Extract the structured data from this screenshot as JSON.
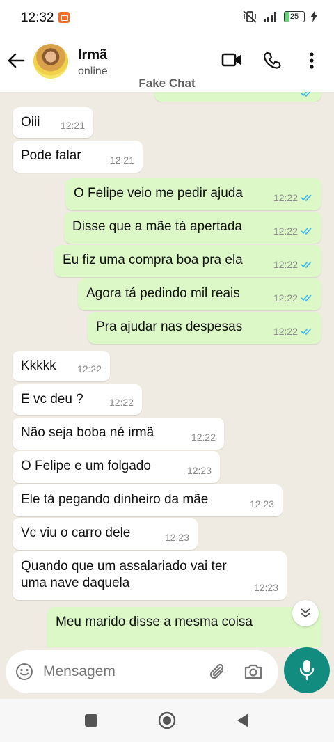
{
  "status_bar": {
    "time": "12:32",
    "battery": "25"
  },
  "header": {
    "contact_name": "Irmã",
    "contact_status": "online",
    "watermark": "Fake Chat"
  },
  "messages": [
    {
      "dir": "in",
      "text": "Oiii",
      "time": "12:21"
    },
    {
      "dir": "in",
      "text": "Pode falar",
      "time": "12:21"
    },
    {
      "dir": "out",
      "text": "O Felipe veio me pedir ajuda",
      "time": "12:22"
    },
    {
      "dir": "out",
      "text": "Disse que a mãe tá apertada",
      "time": "12:22"
    },
    {
      "dir": "out",
      "text": "Eu fiz uma compra boa pra ela",
      "time": "12:22"
    },
    {
      "dir": "out",
      "text": "Agora tá pedindo mil reais",
      "time": "12:22"
    },
    {
      "dir": "out",
      "text": "Pra ajudar nas despesas",
      "time": "12:22"
    },
    {
      "dir": "in",
      "text": "Kkkkk",
      "time": "12:22"
    },
    {
      "dir": "in",
      "text": "E vc deu ?",
      "time": "12:22"
    },
    {
      "dir": "in",
      "text": "Não seja boba né irmã",
      "time": "12:22"
    },
    {
      "dir": "in",
      "text": "O Felipe e um folgado",
      "time": "12:23"
    },
    {
      "dir": "in",
      "text": "Ele tá pegando dinheiro da mãe",
      "time": "12:23"
    },
    {
      "dir": "in",
      "text": "Vc viu o carro dele",
      "time": "12:23"
    },
    {
      "dir": "in",
      "text_line1": "Quando que um assalariado vai ter",
      "text_line2": "uma nave daquela",
      "time": "12:23"
    },
    {
      "dir": "out",
      "text": "Meu marido disse a mesma coisa"
    }
  ],
  "composer": {
    "placeholder": "Mensagem"
  },
  "colors": {
    "incoming": "#ffffff",
    "outgoing": "#dcf8c6",
    "read_ticks": "#34b7f1",
    "mic_button": "#128c7e"
  }
}
